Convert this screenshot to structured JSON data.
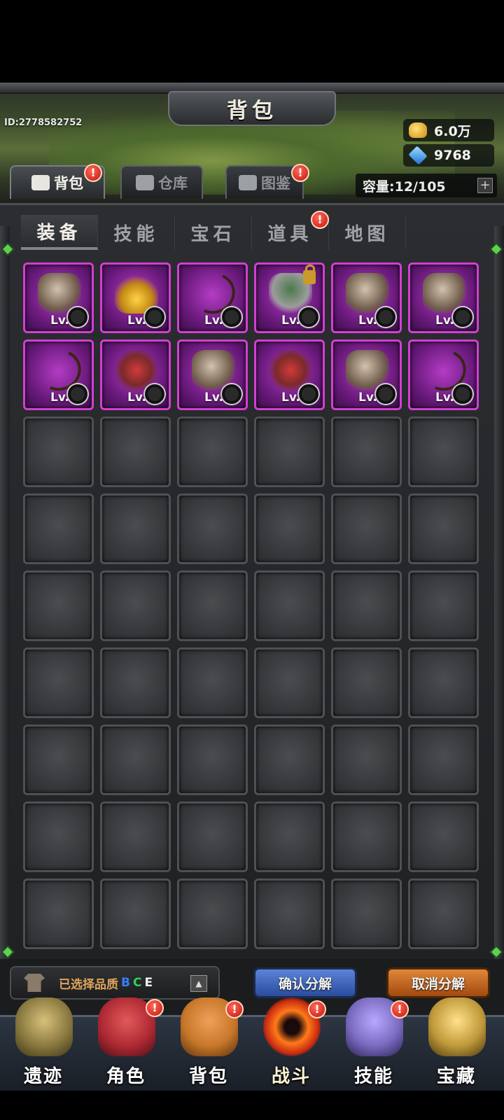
{
  "header": {
    "title": "背包",
    "user_id": "ID:2778582752",
    "gold": "6.0万",
    "gems": "9768",
    "capacity": "容量:12/105",
    "capacity_add": "+"
  },
  "main_tabs": [
    {
      "label": "背包",
      "active": true,
      "alert": "!"
    },
    {
      "label": "仓库",
      "active": false
    },
    {
      "label": "图鉴",
      "active": false,
      "alert": "!"
    }
  ],
  "sub_tabs": [
    {
      "label": "装备",
      "active": true
    },
    {
      "label": "技能"
    },
    {
      "label": "宝石"
    },
    {
      "label": "道具",
      "alert": "!"
    },
    {
      "label": "地图"
    }
  ],
  "items": [
    {
      "name": "ring",
      "level": "Lv."
    },
    {
      "name": "amulet",
      "level": "Lv."
    },
    {
      "name": "bow",
      "level": "Lv."
    },
    {
      "name": "leg-armor",
      "level": "Lv.40",
      "locked": true
    },
    {
      "name": "gloves",
      "level": "Lv."
    },
    {
      "name": "gloves",
      "level": "Lv."
    },
    {
      "name": "bow",
      "level": "Lv."
    },
    {
      "name": "chest-armor",
      "level": "Lv."
    },
    {
      "name": "belt",
      "level": "Lv."
    },
    {
      "name": "chest-armor",
      "level": "Lv."
    },
    {
      "name": "boots",
      "level": "Lv."
    },
    {
      "name": "bow",
      "level": "Lv."
    }
  ],
  "actions": {
    "quality_label": "已选择品质",
    "grade_b": "B",
    "grade_c": "C",
    "grade_e": "E",
    "confirm": "确认分解",
    "cancel": "取消分解",
    "colors": {
      "grade_b": "#3a7cff",
      "grade_c": "#2fd05a",
      "grade_e": "#f0f0f0"
    }
  },
  "nav": [
    {
      "label": "遗迹",
      "color": "#8a7a40"
    },
    {
      "label": "角色",
      "color": "#b02a34",
      "alert": "!"
    },
    {
      "label": "背包",
      "color": "#c8782a",
      "alert": "!"
    },
    {
      "label": "战斗",
      "color": "#e0541a",
      "alert": "!",
      "active": true
    },
    {
      "label": "技能",
      "color": "#7a6ac0",
      "alert": "!"
    },
    {
      "label": "宝藏",
      "color": "#c09a3a"
    }
  ]
}
